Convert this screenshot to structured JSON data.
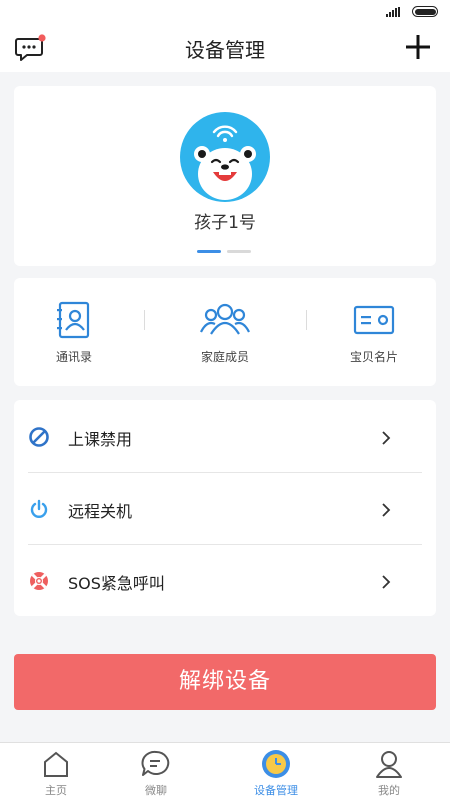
{
  "header": {
    "title": "设备管理"
  },
  "child": {
    "name": "孩子1号",
    "pager_count": 2,
    "pager_active": 1
  },
  "shortcuts": [
    {
      "label": "通讯录",
      "icon": "contacts-icon"
    },
    {
      "label": "家庭成员",
      "icon": "family-icon"
    },
    {
      "label": "宝贝名片",
      "icon": "id-card-icon"
    }
  ],
  "settings": [
    {
      "label": "上课禁用",
      "icon": "ban-icon"
    },
    {
      "label": "远程关机",
      "icon": "power-icon"
    },
    {
      "label": "SOS紧急呼叫",
      "icon": "lifebuoy-icon"
    }
  ],
  "unbind_label": "解绑设备",
  "tabs": [
    {
      "label": "主页",
      "icon": "home-icon",
      "active": false
    },
    {
      "label": "微聊",
      "icon": "chat-icon",
      "active": false
    },
    {
      "label": "设备管理",
      "icon": "watch-icon",
      "active": true
    },
    {
      "label": "我的",
      "icon": "user-icon",
      "active": false
    }
  ],
  "colors": {
    "accent": "#3c8ee6",
    "danger": "#f26969",
    "notification_dot": "#f25c5c",
    "background": "#f4f5f7"
  }
}
